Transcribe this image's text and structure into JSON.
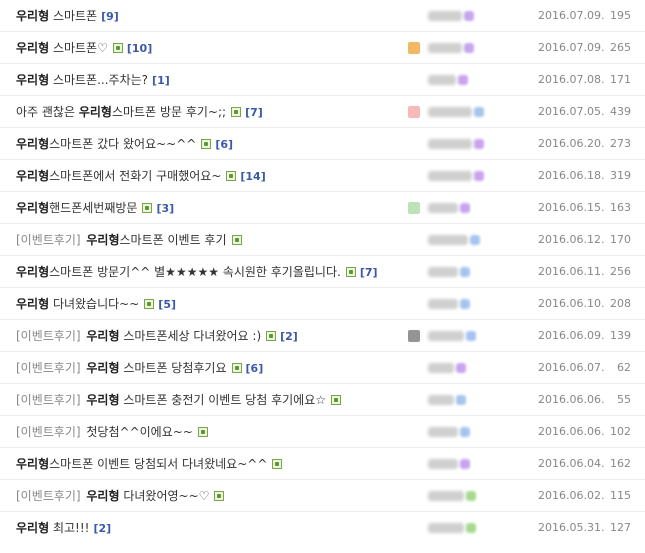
{
  "rows": [
    {
      "prefix": "",
      "kw": "우리형",
      "body": " 스마트폰",
      "img": false,
      "comments": "[9]",
      "date": "2016.07.09.",
      "views": "195",
      "avatar": "",
      "badge": "#c7a4f0"
    },
    {
      "prefix": "",
      "kw": "우리형",
      "body": " 스마트폰♡",
      "img": true,
      "comments": "[10]",
      "date": "2016.07.09.",
      "views": "265",
      "avatar": "#f0a030",
      "badge": "#c7a4f0"
    },
    {
      "prefix": "",
      "kw": "우리형",
      "body": " 스마트폰...주차는?",
      "img": false,
      "comments": "[1]",
      "date": "2016.07.08.",
      "views": "171",
      "avatar": "",
      "badge": "#c7a4f0"
    },
    {
      "prefix": "",
      "kw": "아주 괜찮은 ",
      "kwbold": "우리형",
      "body": "스마트폰 방문 후기~;;",
      "img": true,
      "comments": "[7]",
      "date": "2016.07.05.",
      "views": "439",
      "avatar": "#f4a0a0",
      "badge": "#a6c4f0"
    },
    {
      "prefix": "",
      "kw": "우리형",
      "body": "스마트폰 갔다 왔어요~~^^",
      "img": true,
      "comments": "[6]",
      "date": "2016.06.20.",
      "views": "273",
      "avatar": "",
      "badge": "#c7a4f0"
    },
    {
      "prefix": "",
      "kw": "우리형",
      "body": "스마트폰에서 전화기 구매했어요~",
      "img": true,
      "comments": "[14]",
      "date": "2016.06.18.",
      "views": "319",
      "avatar": "",
      "badge": "#c7a4f0"
    },
    {
      "prefix": "",
      "kw": "우리형",
      "body": "핸드폰세번째방문",
      "img": true,
      "comments": "[3]",
      "date": "2016.06.15.",
      "views": "163",
      "avatar": "#a8d8a0",
      "badge": "#c7a4f0"
    },
    {
      "prefix": "[이벤트후기] ",
      "kw": "우리형",
      "body": "스마트폰 이벤트 후기",
      "img": true,
      "comments": "",
      "date": "2016.06.12.",
      "views": "170",
      "avatar": "",
      "badge": "#a6c4f0"
    },
    {
      "prefix": "",
      "kw": "우리형",
      "body": "스마트폰 방문기^^ 별★★★★★ 속시원한 후기올립니다.",
      "img": true,
      "comments": "[7]",
      "date": "2016.06.11.",
      "views": "256",
      "avatar": "",
      "badge": "#a6c4f0"
    },
    {
      "prefix": "",
      "kw": "우리형",
      "body": " 다녀왔습니다~~",
      "img": true,
      "comments": "[5]",
      "date": "2016.06.10.",
      "views": "208",
      "avatar": "",
      "badge": "#a6c4f0"
    },
    {
      "prefix": "[이벤트후기] ",
      "kw": "우리형",
      "body": " 스마트폰세상 다녀왔어요 :)",
      "img": true,
      "comments": "[2]",
      "date": "2016.06.09.",
      "views": "139",
      "avatar": "#707070",
      "badge": "#a6c4f0"
    },
    {
      "prefix": "[이벤트후기] ",
      "kw": "우리형",
      "body": " 스마트폰 당첨후기요",
      "img": true,
      "comments": "[6]",
      "date": "2016.06.07.",
      "views": "62",
      "avatar": "",
      "badge": "#c7a4f0"
    },
    {
      "prefix": "[이벤트후기] ",
      "kw": "우리형",
      "body": " 스마트폰 충전기 이벤트 당첨 후기에요☆",
      "img": true,
      "comments": "",
      "date": "2016.06.06.",
      "views": "55",
      "avatar": "",
      "badge": "#a6c4f0"
    },
    {
      "prefix": "[이벤트후기] ",
      "kw": "",
      "body": "첫당첨^^이에요~~",
      "img": true,
      "comments": "",
      "date": "2016.06.06.",
      "views": "102",
      "avatar": "",
      "badge": "#a6c4f0"
    },
    {
      "prefix": "",
      "kw": "우리형",
      "body": "스마트폰 이벤트 당첨되서 다녀왔네요~^^",
      "img": true,
      "comments": "",
      "date": "2016.06.04.",
      "views": "162",
      "avatar": "",
      "badge": "#c7a4f0"
    },
    {
      "prefix": "[이벤트후기] ",
      "kw": "우리형",
      "body": " 다녀왔어영~~♡",
      "img": true,
      "comments": "",
      "date": "2016.06.02.",
      "views": "115",
      "avatar": "",
      "badge": "#a8d890"
    },
    {
      "prefix": "",
      "kw": "우리형",
      "body": " 최고!!!",
      "img": false,
      "comments": "[2]",
      "date": "2016.05.31.",
      "views": "127",
      "avatar": "",
      "badge": "#a8d890"
    }
  ]
}
